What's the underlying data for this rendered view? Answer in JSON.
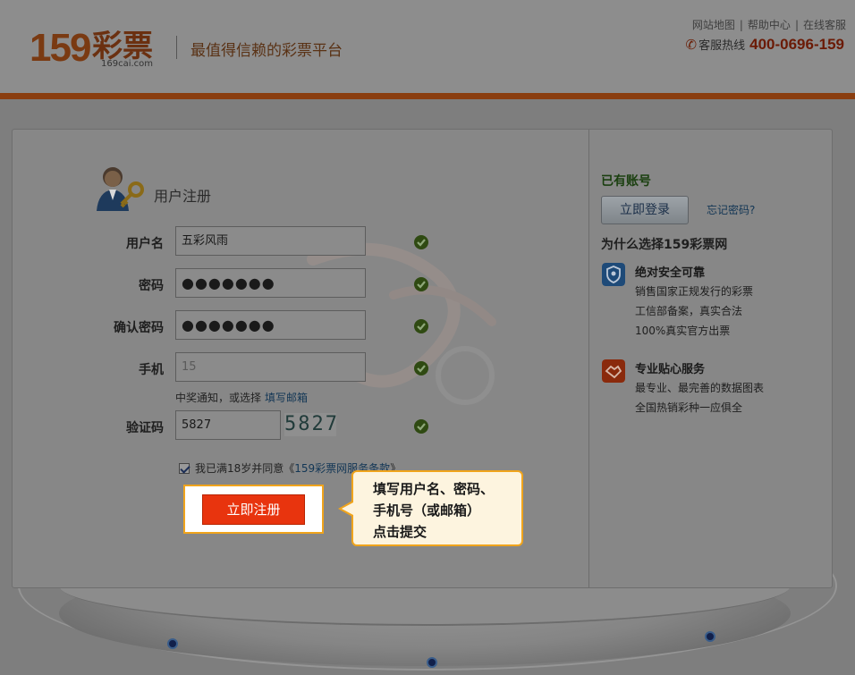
{
  "header": {
    "logo_number": "159",
    "logo_text": "彩票",
    "logo_url": "169cai.com",
    "slogan": "最值得信赖的彩票平台",
    "links": [
      "网站地图",
      "帮助中心",
      "在线客服"
    ],
    "hotline_label": "客服热线",
    "hotline_number": "400-0696-159"
  },
  "form": {
    "title": "用户注册",
    "fields": {
      "username": {
        "label": "用户名",
        "value": "五彩风雨"
      },
      "password": {
        "label": "密码",
        "value": "●●●●●●●"
      },
      "confirm": {
        "label": "确认密码",
        "value": "●●●●●●●"
      },
      "phone": {
        "label": "手机",
        "value": "15"
      },
      "captcha": {
        "label": "验证码",
        "value": "5827"
      }
    },
    "phone_hint": "中奖通知，或选择",
    "phone_hint_link": "填写邮箱",
    "captcha_image_text": "5827",
    "agree_text": "我已满18岁并同意《",
    "agree_link": "159彩票网服务条款",
    "agree_close": "》",
    "submit_label": "立即注册"
  },
  "callout": {
    "line1": "填写用户名、密码、",
    "line2": "手机号（或邮箱）",
    "line3": "点击提交"
  },
  "sidebar": {
    "have_account": "已有账号",
    "login_label": "立即登录",
    "forgot_label": "忘记密码?",
    "why_title": "为什么选择159彩票网",
    "features": [
      {
        "icon": "shield-icon",
        "title": "绝对安全可靠",
        "lines": [
          "销售国家正规发行的彩票",
          "工信部备案，真实合法",
          "100%真实官方出票"
        ]
      },
      {
        "icon": "handshake-icon",
        "title": "专业贴心服务",
        "lines": [
          "最专业、最完善的数据图表",
          "全国热销彩种一应俱全"
        ]
      }
    ]
  },
  "colors": {
    "accent": "#e8340e",
    "callout_border": "#f0a41c",
    "callout_bg": "#fdf4df",
    "header_rule": "#8a3e10"
  }
}
